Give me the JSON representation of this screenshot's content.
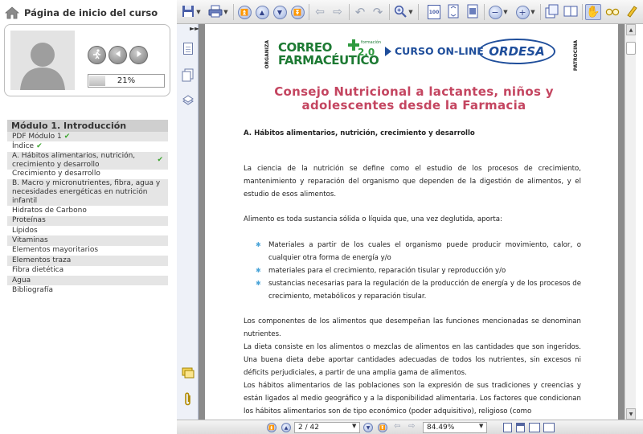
{
  "sidebar": {
    "home_title": "Página de inicio del curso",
    "progress_text": "21%",
    "progress_value": 0.21,
    "module_title": "Módulo 1. Introducción",
    "items": [
      {
        "label": "PDF Módulo 1",
        "check": "✔"
      },
      {
        "label": "Índice",
        "check": "✔"
      },
      {
        "label": "A. Hábitos alimentarios, nutrición, crecimiento y desarrollo",
        "check": "✔"
      },
      {
        "label": "Crecimiento y desarrollo",
        "check": ""
      },
      {
        "label": "B. Macro y micronutrientes, fibra, agua y necesidades energéticas en nutrición infantil",
        "check": ""
      },
      {
        "label": "Hidratos de Carbono",
        "check": ""
      },
      {
        "label": "Proteínas",
        "check": ""
      },
      {
        "label": "Lípidos",
        "check": ""
      },
      {
        "label": "Vitaminas",
        "check": ""
      },
      {
        "label": "Elementos mayoritarios",
        "check": ""
      },
      {
        "label": "Elementos traza",
        "check": ""
      },
      {
        "label": "Fibra dietética",
        "check": ""
      },
      {
        "label": "Agua",
        "check": ""
      },
      {
        "label": "Bibliografía",
        "check": ""
      }
    ]
  },
  "toolbar": {
    "zoom_100_label": "100",
    "accent_color": "#4a5fa8"
  },
  "document": {
    "logo": {
      "organiza": "ORGANIZA",
      "correo": "CORREO",
      "formacion": "formación",
      "two_oh": "2.0",
      "farmaceutico": "FARMACÉUTICO",
      "online": "CURSO ON-LINE",
      "ordesa": "ORDESA",
      "patrocina": "PATROCINA"
    },
    "headline_line1": "Consejo Nutricional a lactantes, niños y",
    "headline_line2": "adolescentes desde la Farmacia",
    "section_heading": "A. Hábitos alimentarios, nutrición, crecimiento y desarrollo",
    "paragraph1": "La ciencia de la nutrición se define como el estudio de los procesos de crecimiento, mantenimiento y reparación del organismo que dependen de la digestión de alimentos, y el estudio de esos alimentos.",
    "paragraph2": "Alimento es toda sustancia sólida o líquida que, una vez deglutida, aporta:",
    "bullets": [
      "Materiales a partir de los cuales el organismo puede producir movimiento, calor, o cualquier otra forma de energía y/o",
      "materiales para el crecimiento, reparación tisular y reproducción y/o",
      "sustancias necesarias para la regulación de la producción de energía y de los procesos de crecimiento, metabólicos y reparación tisular."
    ],
    "paragraph3": "Los componentes de los alimentos que desempeñan las funciones mencionadas se denominan nutrientes.",
    "paragraph4": "La dieta consiste en los alimentos o mezclas de alimentos en las cantidades que son ingeridos. Una buena dieta debe aportar cantidades adecuadas de todos los nutrientes, sin excesos ni déficits perjudiciales, a partir de una amplia gama de alimentos.",
    "paragraph5": "Los hábitos alimentarios de las poblaciones son la expresión de sus tradiciones y creencias y están ligados al medio geográfico y a la disponibilidad alimentaria. Los factores que condicionan los hábitos alimentarios son de tipo económico (poder adquisitivo), religioso (como"
  },
  "bottombar": {
    "page_indicator": "2 / 42",
    "zoom_value": "84.49%"
  }
}
